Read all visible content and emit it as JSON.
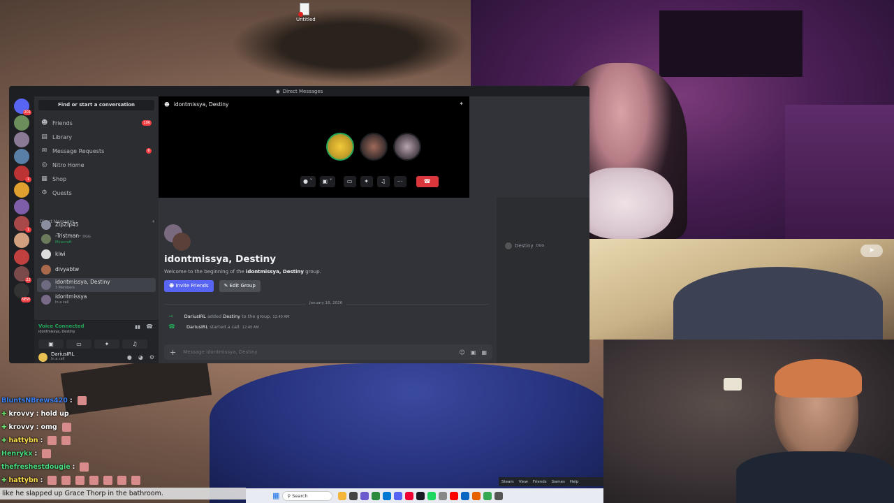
{
  "desktop": {
    "icon_label": "Untitled"
  },
  "discord": {
    "window_title": "Direct Messages",
    "server_badges": [
      "201",
      "",
      "",
      "",
      "1",
      "",
      "",
      "1",
      "",
      "22",
      "NEW"
    ],
    "search_placeholder": "Find or start a conversation",
    "nav": [
      {
        "label": "Friends",
        "icon": "friends-icon",
        "count": "196"
      },
      {
        "label": "Library",
        "icon": "library-icon",
        "count": ""
      },
      {
        "label": "Message Requests",
        "icon": "mail-icon",
        "count": "6"
      },
      {
        "label": "Nitro Home",
        "icon": "nitro-icon",
        "count": ""
      },
      {
        "label": "Shop",
        "icon": "shop-icon",
        "count": ""
      },
      {
        "label": "Quests",
        "icon": "quests-icon",
        "count": ""
      }
    ],
    "dm_header": "Direct Messages",
    "dm_add": "+",
    "dms": [
      {
        "name": "ZipZip45",
        "sub": ""
      },
      {
        "name": "-Tristman-",
        "sub": "Minecraft",
        "tag": "DGG"
      },
      {
        "name": "kiwi",
        "sub": ""
      },
      {
        "name": "divyabtw",
        "sub": ""
      },
      {
        "name": "idontmissya, Destiny",
        "sub": "3 Members"
      },
      {
        "name": "idontmissya",
        "sub": "In a call"
      }
    ],
    "voice": {
      "status": "Voice Connected",
      "channel": "idontmissya, Destiny"
    },
    "user": {
      "name": "DariusIRL",
      "status": "In a call"
    },
    "call": {
      "header": "idontmissya, Destiny"
    },
    "intro": {
      "title": "idontmissya, Destiny",
      "welcome_pre": "Welcome to the beginning of the ",
      "welcome_bold": "idontmissya, Destiny",
      "welcome_post": " group.",
      "invite_label": "Invite Friends",
      "edit_label": "Edit Group"
    },
    "date_divider": "January 16, 2026",
    "messages": [
      {
        "user": "DariusIRL",
        "text_pre": "added",
        "target": "Destiny",
        "text_post": "to the group.",
        "time": "12:40 AM"
      },
      {
        "user": "DariusIRL",
        "text_pre": "started a call.",
        "target": "",
        "text_post": "",
        "time": "12:40 AM"
      }
    ],
    "composer_placeholder": "Message idontmissya, Destiny",
    "member": {
      "name": "Destiny",
      "tag": "DGG"
    }
  },
  "twitch_chat": [
    {
      "user": "BluntsNBrews420",
      "color": "#3b82f6",
      "text": "",
      "emotes": 1,
      "badge": ""
    },
    {
      "user": "krovvy",
      "color": "#ffffff",
      "text": "hold up",
      "emotes": 0,
      "badge": "✚"
    },
    {
      "user": "krovvy",
      "color": "#ffffff",
      "text": "omg",
      "emotes": 1,
      "badge": "✚"
    },
    {
      "user": "hattybn",
      "color": "#ffe14d",
      "text": "",
      "emotes": 2,
      "badge": "✚"
    },
    {
      "user": "Henrykx",
      "color": "#4ade80",
      "text": "",
      "emotes": 1,
      "badge": ""
    },
    {
      "user": "thefreshestdougie",
      "color": "#4ade80",
      "text": "",
      "emotes": 1,
      "badge": ""
    },
    {
      "user": "hattybn",
      "color": "#ffe14d",
      "text": "",
      "emotes": 7,
      "badge": "✚"
    }
  ],
  "caption": "like he slapped up Grace Thorp in the bathroom.",
  "taskbar": {
    "search_label": "Search"
  },
  "steam_menu": [
    "Steam",
    "View",
    "Friends",
    "Games",
    "Help"
  ],
  "colors": {
    "discord_bg": "#313338",
    "blurple": "#5865f2",
    "hangup": "#da373c",
    "voice_green": "#23a559"
  }
}
